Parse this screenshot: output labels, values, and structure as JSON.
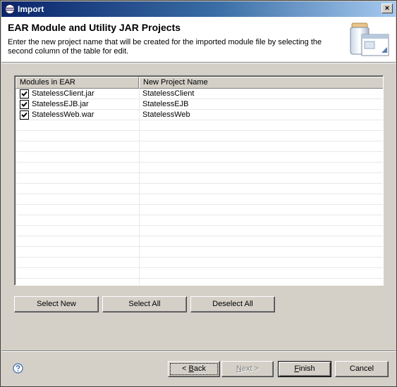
{
  "window": {
    "title": "Import",
    "close_label": "×"
  },
  "header": {
    "heading": "EAR Module and Utility JAR Projects",
    "description": "Enter the new project name that will be created for the imported module file by selecting the second column of the table for edit."
  },
  "table": {
    "columns": [
      "Modules in EAR",
      "New Project Name"
    ],
    "rows": [
      {
        "module": "StatelessClient.jar",
        "project": "StatelessClient",
        "checked": true
      },
      {
        "module": "StatelessEJB.jar",
        "project": "StatelessEJB",
        "checked": true
      },
      {
        "module": "StatelessWeb.war",
        "project": "StatelessWeb",
        "checked": true
      }
    ]
  },
  "actions": {
    "select_new": "Select New",
    "select_all": "Select All",
    "deselect_all": "Deselect All"
  },
  "footer": {
    "back_prefix": "< ",
    "back_mnemonic": "B",
    "back_rest": "ack",
    "next_mnemonic": "N",
    "next_rest": "ext >",
    "finish_mnemonic": "F",
    "finish_rest": "inish",
    "cancel": "Cancel"
  },
  "icons": {
    "app": "eclipse-icon",
    "help": "help-icon",
    "wizard": "import-wizard-icon",
    "check": "checkmark-icon"
  }
}
